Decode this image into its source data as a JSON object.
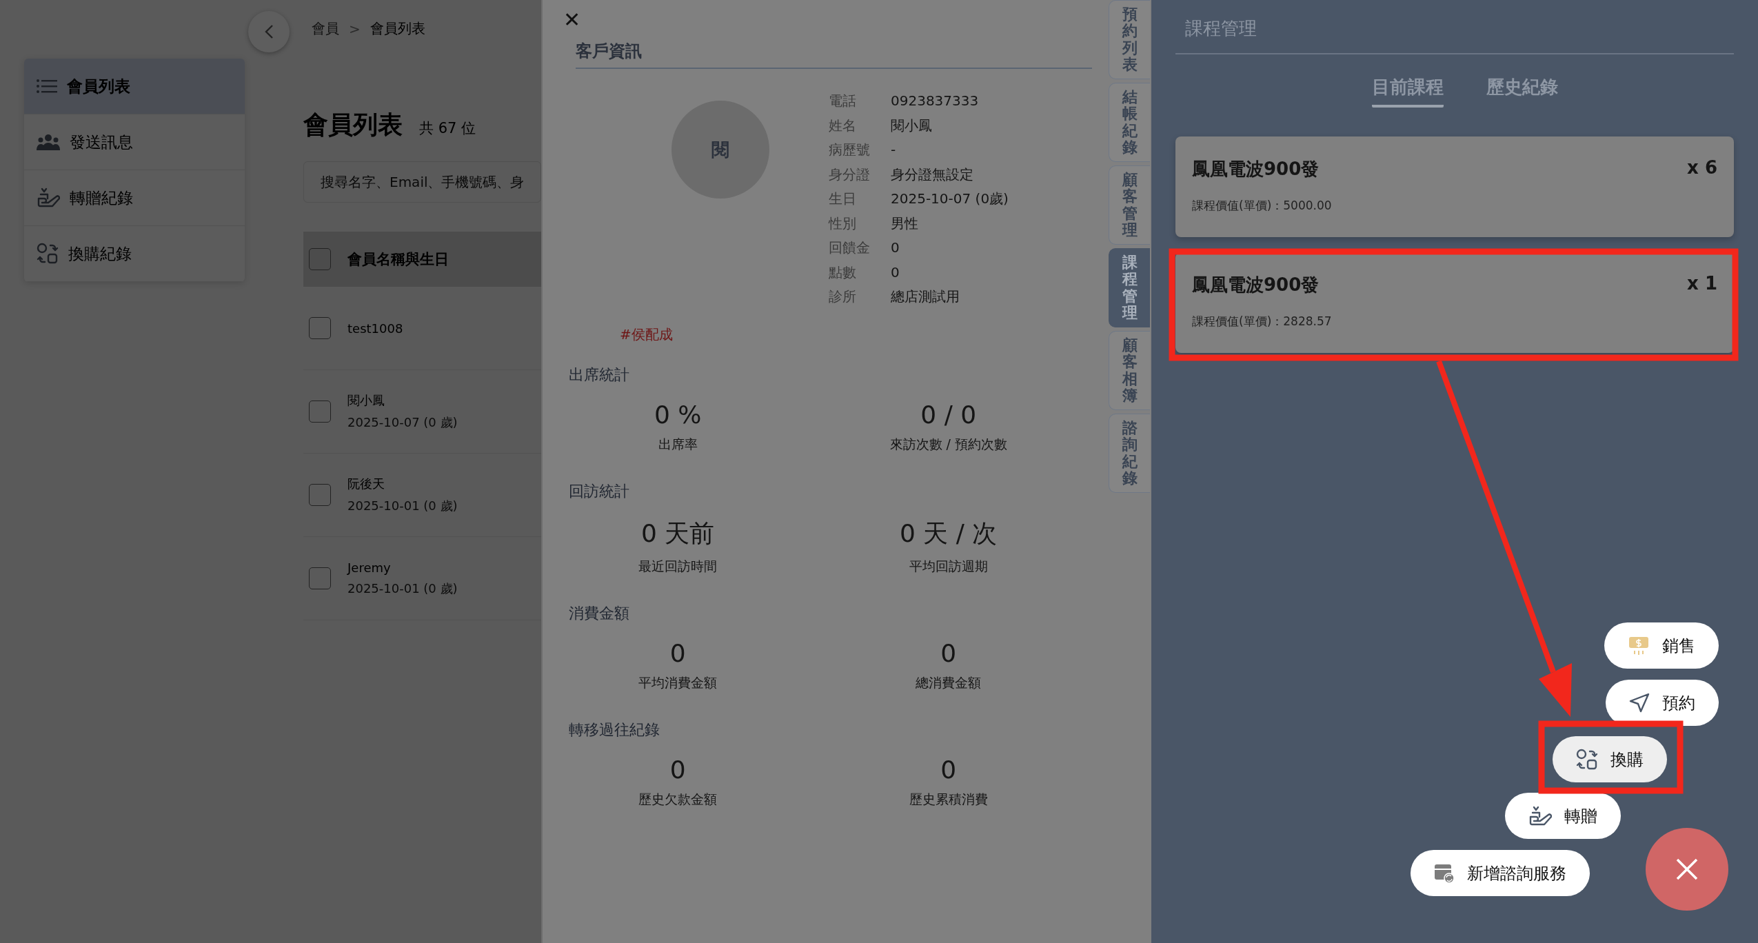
{
  "sidebar": {
    "items": [
      {
        "label": "會員列表",
        "selected": true
      },
      {
        "label": "發送訊息",
        "selected": false
      },
      {
        "label": "轉贈紀錄",
        "selected": false
      },
      {
        "label": "換購紀錄",
        "selected": false
      }
    ]
  },
  "breadcrumb": {
    "items": [
      "會員",
      "會員列表"
    ],
    "separator": ">"
  },
  "page": {
    "title": "會員列表",
    "count": "共 67 位",
    "search_placeholder": "搜尋名字、Email、手機號碼、身"
  },
  "table": {
    "header": {
      "label": "會員名稱與生日",
      "checked": false
    },
    "rows": [
      {
        "name": "test1008",
        "checked": false
      },
      {
        "name": "閱小鳳",
        "birthday": "2025-10-07 (0 歲)",
        "checked": false
      },
      {
        "name": "阮後天",
        "birthday": "2025-10-01 (0 歲)",
        "checked": false
      },
      {
        "name": "Jeremy",
        "birthday": "2025-10-01 (0 歲)",
        "checked": false
      }
    ]
  },
  "drawer": {
    "close": "✕",
    "title": "客戶資訊",
    "avatar": "閱",
    "fields": [
      {
        "label": "電話",
        "value": "0923837333"
      },
      {
        "label": "姓名",
        "value": "閱小鳳"
      },
      {
        "label": "病歷號",
        "value": "-"
      },
      {
        "label": "身分證",
        "value": "身分證無設定"
      },
      {
        "label": "生日",
        "value": "2025-10-07 (0歲)"
      },
      {
        "label": "性別",
        "value": "男性"
      },
      {
        "label": "回饋金",
        "value": "0"
      },
      {
        "label": "點數",
        "value": "0"
      },
      {
        "label": "診所",
        "value": "總店測試用"
      }
    ],
    "tag": "#侯配成",
    "sections": [
      {
        "title": "出席統計",
        "stats": [
          {
            "value": "0 %",
            "label": "出席率"
          },
          {
            "value": "0 / 0",
            "label": "來訪次數 / 預約次數"
          }
        ]
      },
      {
        "title": "回訪統計",
        "stats": [
          {
            "value": "0 天前",
            "label": "最近回訪時間"
          },
          {
            "value": "0 天 / 次",
            "label": "平均回訪週期"
          }
        ]
      },
      {
        "title": "消費金額",
        "stats": [
          {
            "value": "0",
            "label": "平均消費金額"
          },
          {
            "value": "0",
            "label": "總消費金額"
          }
        ]
      },
      {
        "title": "轉移過往紀錄",
        "stats": [
          {
            "value": "0",
            "label": "歷史欠款金額"
          },
          {
            "value": "0",
            "label": "歷史累積消費"
          }
        ]
      }
    ]
  },
  "side_tabs": [
    {
      "label": "預約列表",
      "selected": false
    },
    {
      "label": "結帳紀錄",
      "selected": false
    },
    {
      "label": "顧客管理",
      "selected": false
    },
    {
      "label": "課程管理",
      "selected": true
    },
    {
      "label": "顧客相簿",
      "selected": false
    },
    {
      "label": "諮詢紀錄",
      "selected": false
    }
  ],
  "course_panel": {
    "title": "課程管理",
    "tabs": [
      {
        "label": "目前課程",
        "selected": true
      },
      {
        "label": "歷史紀錄",
        "selected": false
      }
    ],
    "courses": [
      {
        "name": "鳳凰電波900發",
        "quantity": "x 6",
        "price": "課程價值(單價)：5000.00"
      },
      {
        "name": "鳳凰電波900發",
        "quantity": "x 1",
        "price": "課程價值(單價)：2828.57"
      }
    ]
  },
  "actions": [
    {
      "kind": "sale",
      "label": "銷售",
      "selected": false
    },
    {
      "kind": "booking",
      "label": "預約",
      "selected": false
    },
    {
      "kind": "exchange",
      "label": "換購",
      "selected": true
    },
    {
      "kind": "gift",
      "label": "轉贈",
      "selected": false
    },
    {
      "kind": "consult",
      "label": "新增諮詢服務",
      "selected": false
    }
  ]
}
